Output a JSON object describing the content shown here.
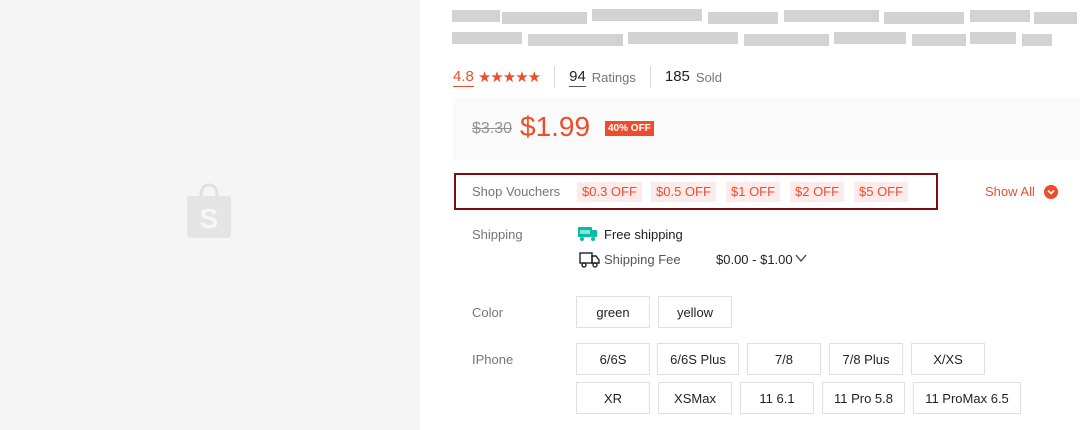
{
  "product": {
    "rating": "4.8",
    "stars": "★★★★★",
    "ratings_count": "94",
    "ratings_label": "Ratings",
    "sold_count": "185",
    "sold_label": "Sold"
  },
  "price": {
    "original": "$3.30",
    "current": "$1.99",
    "discount_badge": "40% OFF"
  },
  "vouchers": {
    "label": "Shop Vouchers",
    "items": [
      "$0.3 OFF",
      "$0.5 OFF",
      "$1 OFF",
      "$2 OFF",
      "$5 OFF"
    ],
    "show_all": "Show All"
  },
  "shipping": {
    "label": "Shipping",
    "free_text": "Free shipping",
    "fee_label": "Shipping Fee",
    "fee_value": "$0.00 - $1.00"
  },
  "color": {
    "label": "Color",
    "options": [
      "green",
      "yellow"
    ]
  },
  "iphone": {
    "label": "IPhone",
    "options": [
      "6/6S",
      "6/6S Plus",
      "7/8",
      "7/8 Plus",
      "X/XS",
      "XR",
      "XSMax",
      "11 6.1",
      "11 Pro 5.8",
      "11 ProMax 6.5"
    ]
  },
  "icons": {
    "logo": "shop-bag-logo",
    "free_shipping": "free-shipping-icon",
    "truck": "truck-icon",
    "fee_toggle": "chevron-down-icon",
    "show_all": "chevron-down-circle-icon"
  },
  "colors": {
    "accent": "#ee4d2d",
    "voucher_bg": "#fdeaea",
    "highlight_frame": "#7a0c14",
    "free_ship_teal": "#00bfa5"
  }
}
